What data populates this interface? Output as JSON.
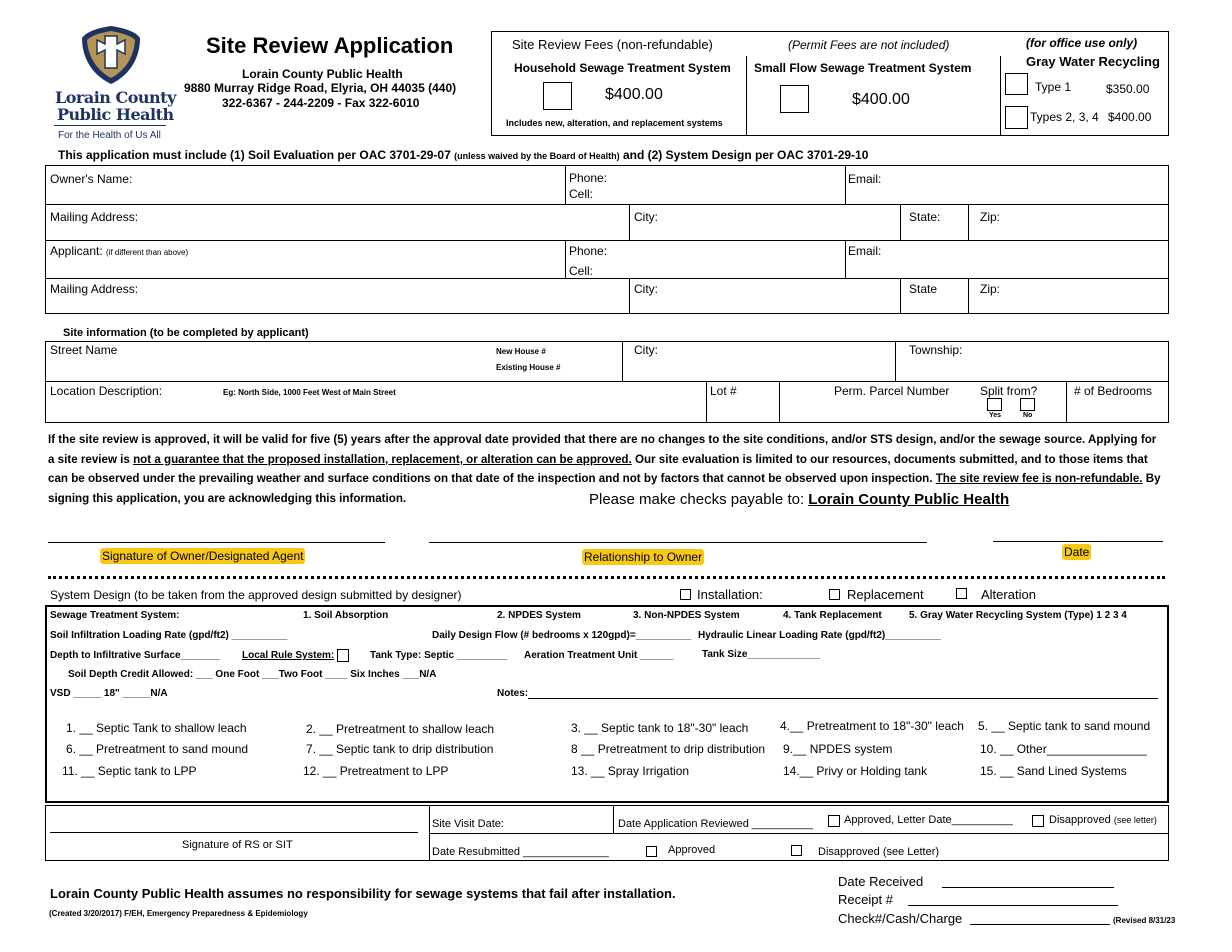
{
  "header": {
    "logo_line1": "Lorain County",
    "logo_line2": "Public Health",
    "logo_tagline": "For the Health of Us All",
    "title": "Site Review Application",
    "org": "Lorain County Public Health",
    "address": "9880 Murray Ridge Road, Elyria, OH  44035 (440)",
    "phones": "322-6367 - 244-2209 - Fax 322-6010"
  },
  "fees": {
    "heading": "Site Review Fees (non-refundable)",
    "permit_note": "(Permit Fees are not included)",
    "office_note": "(for office use only)",
    "household_label": "Household Sewage Treatment System",
    "household_price": "$400.00",
    "household_note": "Includes new, alteration, and replacement systems",
    "smallflow_label": "Small Flow Sewage Treatment System",
    "smallflow_price": "$400.00",
    "gray_label": "Gray Water Recycling",
    "type1_label": "Type 1",
    "type1_price": "$350.00",
    "type234_label": "Types 2, 3, 4",
    "type234_price": "$400.00"
  },
  "requirement": {
    "part1": "This application must include (1) Soil Evaluation per OAC 3701-29-07 ",
    "small": "(unless waived by the Board of Health)",
    "part2": " and (2) System Design per OAC 3701-29-10"
  },
  "owner": {
    "owner_name": "Owner's Name:",
    "phone": "Phone:",
    "cell": "Cell:",
    "email": "Email:",
    "mailing": "Mailing Address:",
    "city": "City:",
    "state": "State:",
    "zip": "Zip:",
    "applicant": "Applicant: ",
    "applicant_note": "(if different than above)",
    "state2": "State"
  },
  "site": {
    "heading": "Site information (to be completed by applicant)",
    "street": "Street Name",
    "new_house": "New House #",
    "existing_house": "Existing House #",
    "city": "City:",
    "township": "Township:",
    "location": "Location Description:",
    "location_eg": "Eg: North Side, 1000 Feet West of Main Street",
    "lot": "Lot #",
    "parcel": "Perm. Parcel Number",
    "split": "Split from?",
    "yes": "Yes",
    "no": "No",
    "bedrooms": "# of Bedrooms"
  },
  "disclaimer": {
    "t1": "If the site review is approved, it will be valid for five (5) years after the approval date provided that there are no changes to the site conditions, and/or STS design, and/or the sewage source.  Applying for a site review is ",
    "u1": "not a guarantee that the proposed installation, replacement, or alteration can be approved.",
    "t2": " Our site evaluation is limited to our resources, documents submitted, and to those items that can be observed under the prevailing weather and surface conditions on that date of the inspection and not by factors that cannot be observed upon inspection. ",
    "u2": "The site review fee is non-refundable.",
    "t3": " By signing this application, you are acknowledging this information.",
    "checks_label": "Please make checks payable to: ",
    "checks_payee": "Lorain County Public Health"
  },
  "signatures": {
    "owner": "Signature of Owner/Designated Agent",
    "relationship": "Relationship to Owner",
    "date": "Date"
  },
  "system_design": {
    "heading": "System Design (to be taken from the approved design submitted by designer)",
    "installation": "Installation:",
    "replacement": "Replacement",
    "alteration": "Alteration",
    "sts": "Sewage Treatment System:",
    "opt1": "1.  Soil Absorption",
    "opt2": "2.   NPDES System",
    "opt3": "3.   Non-NPDES System",
    "opt4": "4.  Tank Replacement",
    "opt5": "5. Gray Water Recycling System (Type)   1   2   3   4",
    "silr": "Soil Infiltration Loading Rate (gpd/ft2) __________",
    "ddf": "Daily Design Flow (# bedrooms x 120gpd)=__________",
    "hllr": "Hydraulic Linear Loading Rate (gpd/ft2)__________",
    "depth": "Depth to Infiltrative Surface_______",
    "local_rule": "Local Rule System:",
    "tank_type": "Tank Type:   Septic _________",
    "atu": "Aeration Treatment Unit ______",
    "tank_size": "Tank Size_____________",
    "credit": "Soil Depth Credit Allowed:  ___ One Foot   ___Two Foot   ____ Six Inches   ___N/A",
    "vsd": "VSD    _____ 18\"    _____N/A",
    "notes": "Notes:",
    "items": [
      "1.  __  Septic Tank to shallow leach",
      "2.  __ Pretreatment to shallow leach",
      "3.  __ Septic tank to 18\"-30\" leach",
      "4.__  Pretreatment to 18\"-30\" leach",
      "5.  __  Septic tank to sand mound",
      "6.  __   Pretreatment to sand mound",
      "7.  __ Septic tank to drip distribution",
      "8   __  Pretreatment to drip distribution",
      "9.__   NPDES system",
      "10.  __  Other_______________",
      "11. __ Septic tank to LPP",
      "12. __   Pretreatment to LPP",
      "13. __ Spray Irrigation",
      "14.__  Privy or Holding tank",
      "15.  __   Sand Lined Systems"
    ]
  },
  "office": {
    "rs_sig": "Signature of RS or SIT",
    "site_visit": "Site Visit Date:",
    "date_reviewed": "Date Application Reviewed __________",
    "approved_letter": "Approved, Letter Date__________",
    "disapproved_letter": "Disapproved ",
    "see_letter": "(see letter)",
    "resubmitted": "Date Resubmitted ______________",
    "approved": "Approved",
    "disapproved2": "Disapproved (see Letter)"
  },
  "footer": {
    "liability": "Lorain County Public Health assumes no responsibility for sewage systems that fail after installation.",
    "created": "(Created 3/20/2017)  F/EH, Emergency Preparedness & Epidemiology",
    "date_received": "Date Received",
    "receipt": "Receipt #",
    "check": "Check#/Cash/Charge",
    "revised": "(Revised 8/31/23"
  },
  "colors": {
    "logo_navy": "#1f3264",
    "logo_gold": "#b39556",
    "highlight": "#f7c815"
  }
}
